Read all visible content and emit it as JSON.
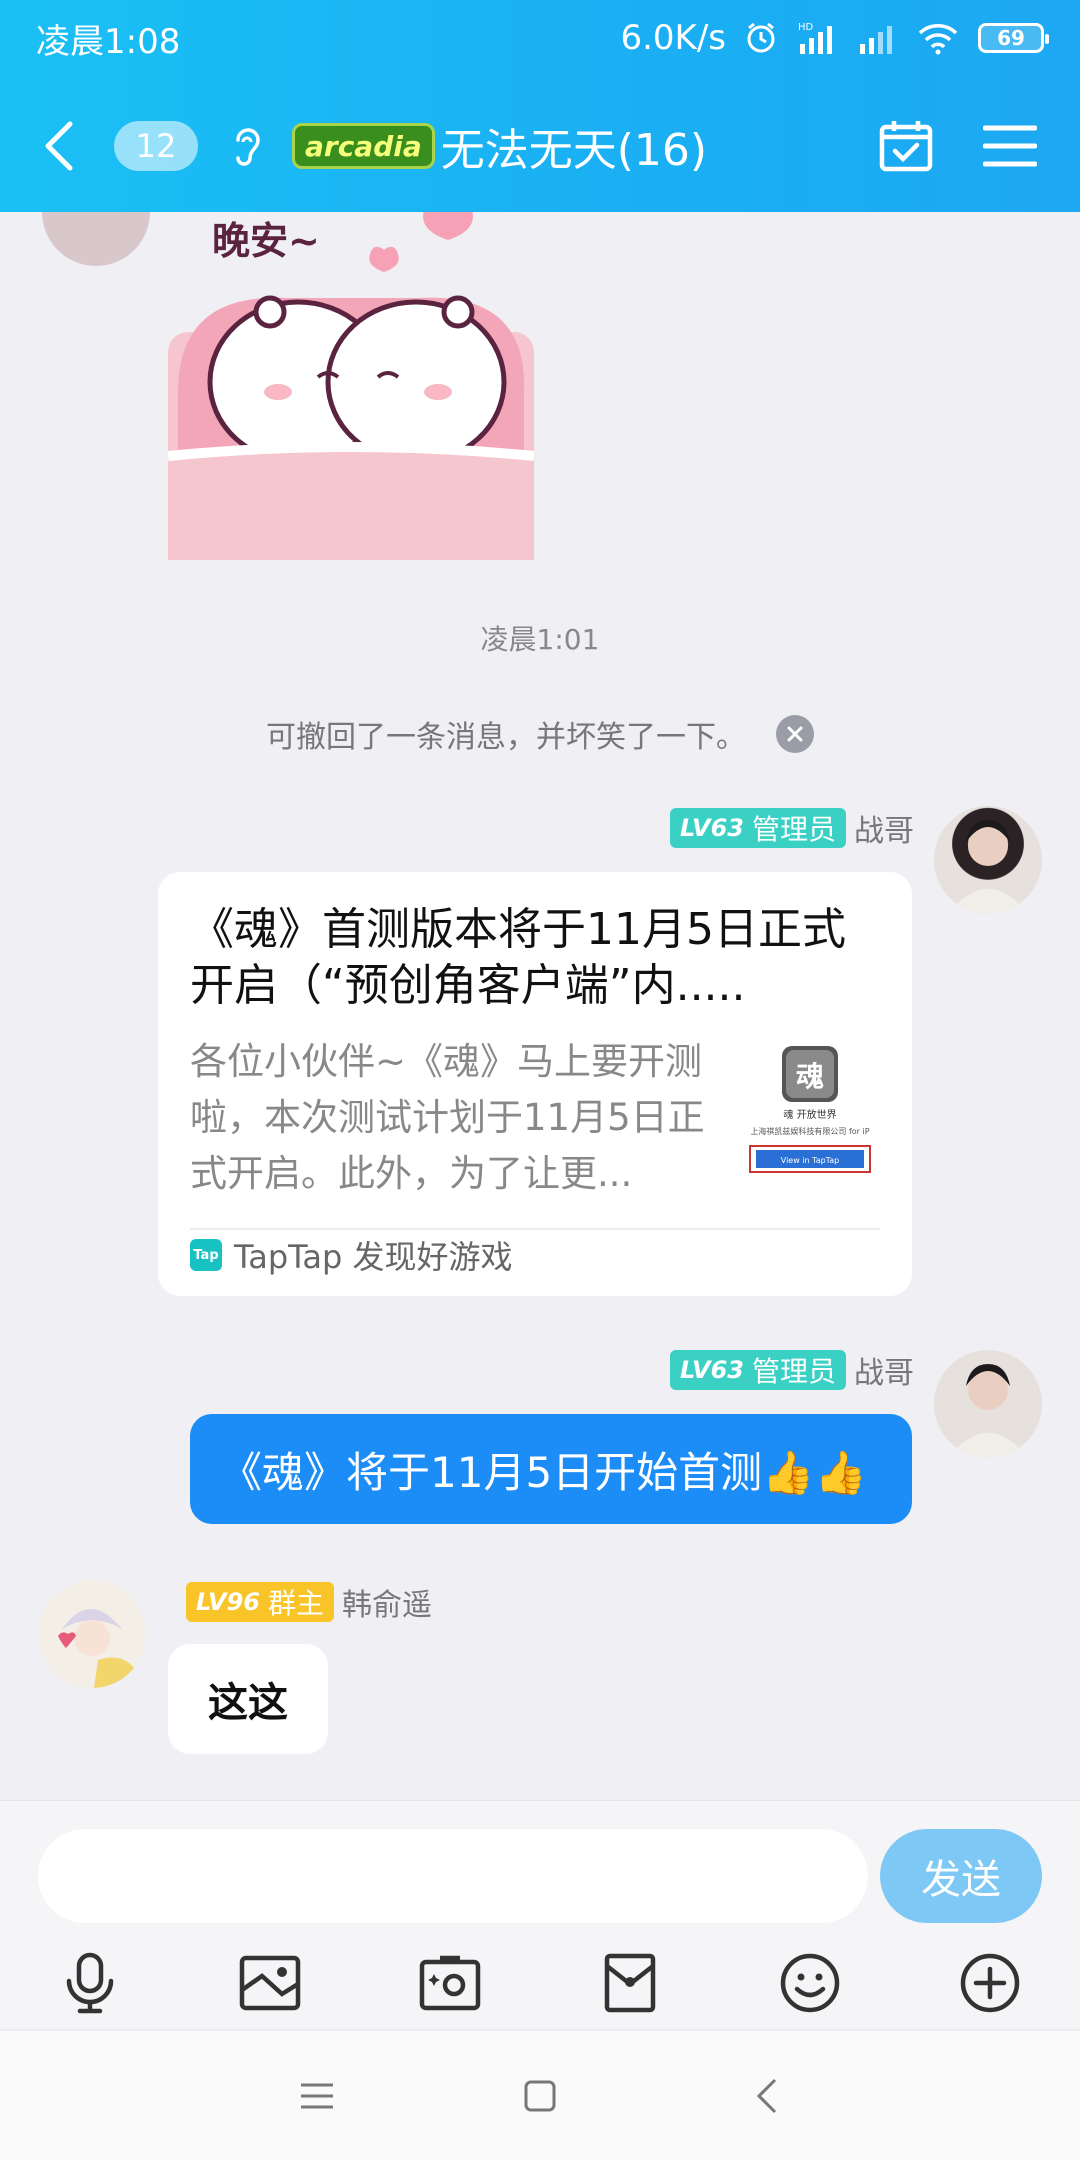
{
  "status_bar": {
    "time": "凌晨1:08",
    "net_speed": "6.0K/s",
    "hd_label": "HD",
    "battery": "69"
  },
  "header": {
    "unread_count": "12",
    "group_badge": "arcadia",
    "group_title": "无法无天(16)"
  },
  "chat": {
    "sticker_text": "晚安~",
    "time_label": "凌晨1:01",
    "recall_text": "可撤回了一条消息，并坏笑了一下。",
    "messages": [
      {
        "level": "LV63",
        "role": "管理员",
        "sender": "战哥",
        "card": {
          "title": "《魂》首测版本将于11月5日正式开启（“预创角客户端”内.....",
          "description": "各位小伙伴~《魂》马上要开测啦，本次测试计划于11月5日正式开启。此外，为了让更...",
          "thumb_title": "魂 开放世界",
          "thumb_sub": "上海祺凯兹娱科技有限公司 for iP",
          "thumb_button": "View in TapTap",
          "source_logo": "Tap",
          "source": "TapTap 发现好游戏"
        }
      },
      {
        "level": "LV63",
        "role": "管理员",
        "sender": "战哥",
        "text": "《魂》将于11月5日开始首测👍👍"
      },
      {
        "level": "LV96",
        "role": "群主",
        "sender": "韩俞遥",
        "text": "这这"
      }
    ]
  },
  "input": {
    "value": "",
    "send_label": "发送"
  },
  "toolbar_icons": [
    "microphone-icon",
    "photo-icon",
    "camera-icon",
    "red-packet-icon",
    "emoji-icon",
    "plus-icon"
  ],
  "colors": {
    "header": "#1ab4f3",
    "bubble_self": "#1c8cf7",
    "badge_admin": "#3bd0c4",
    "badge_owner": "#f9c428",
    "send_button": "#7ec8f5"
  }
}
